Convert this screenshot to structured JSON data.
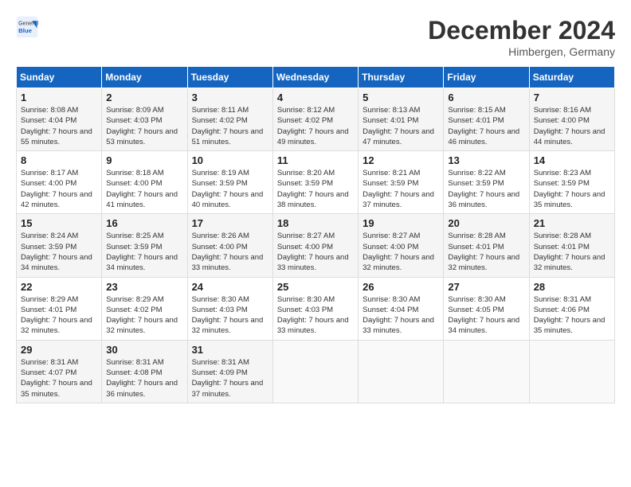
{
  "header": {
    "logo_general": "General",
    "logo_blue": "Blue",
    "month_title": "December 2024",
    "location": "Himbergen, Germany"
  },
  "days_of_week": [
    "Sunday",
    "Monday",
    "Tuesday",
    "Wednesday",
    "Thursday",
    "Friday",
    "Saturday"
  ],
  "weeks": [
    [
      {
        "day": "1",
        "sunrise": "Sunrise: 8:08 AM",
        "sunset": "Sunset: 4:04 PM",
        "daylight": "Daylight: 7 hours and 55 minutes."
      },
      {
        "day": "2",
        "sunrise": "Sunrise: 8:09 AM",
        "sunset": "Sunset: 4:03 PM",
        "daylight": "Daylight: 7 hours and 53 minutes."
      },
      {
        "day": "3",
        "sunrise": "Sunrise: 8:11 AM",
        "sunset": "Sunset: 4:02 PM",
        "daylight": "Daylight: 7 hours and 51 minutes."
      },
      {
        "day": "4",
        "sunrise": "Sunrise: 8:12 AM",
        "sunset": "Sunset: 4:02 PM",
        "daylight": "Daylight: 7 hours and 49 minutes."
      },
      {
        "day": "5",
        "sunrise": "Sunrise: 8:13 AM",
        "sunset": "Sunset: 4:01 PM",
        "daylight": "Daylight: 7 hours and 47 minutes."
      },
      {
        "day": "6",
        "sunrise": "Sunrise: 8:15 AM",
        "sunset": "Sunset: 4:01 PM",
        "daylight": "Daylight: 7 hours and 46 minutes."
      },
      {
        "day": "7",
        "sunrise": "Sunrise: 8:16 AM",
        "sunset": "Sunset: 4:00 PM",
        "daylight": "Daylight: 7 hours and 44 minutes."
      }
    ],
    [
      {
        "day": "8",
        "sunrise": "Sunrise: 8:17 AM",
        "sunset": "Sunset: 4:00 PM",
        "daylight": "Daylight: 7 hours and 42 minutes."
      },
      {
        "day": "9",
        "sunrise": "Sunrise: 8:18 AM",
        "sunset": "Sunset: 4:00 PM",
        "daylight": "Daylight: 7 hours and 41 minutes."
      },
      {
        "day": "10",
        "sunrise": "Sunrise: 8:19 AM",
        "sunset": "Sunset: 3:59 PM",
        "daylight": "Daylight: 7 hours and 40 minutes."
      },
      {
        "day": "11",
        "sunrise": "Sunrise: 8:20 AM",
        "sunset": "Sunset: 3:59 PM",
        "daylight": "Daylight: 7 hours and 38 minutes."
      },
      {
        "day": "12",
        "sunrise": "Sunrise: 8:21 AM",
        "sunset": "Sunset: 3:59 PM",
        "daylight": "Daylight: 7 hours and 37 minutes."
      },
      {
        "day": "13",
        "sunrise": "Sunrise: 8:22 AM",
        "sunset": "Sunset: 3:59 PM",
        "daylight": "Daylight: 7 hours and 36 minutes."
      },
      {
        "day": "14",
        "sunrise": "Sunrise: 8:23 AM",
        "sunset": "Sunset: 3:59 PM",
        "daylight": "Daylight: 7 hours and 35 minutes."
      }
    ],
    [
      {
        "day": "15",
        "sunrise": "Sunrise: 8:24 AM",
        "sunset": "Sunset: 3:59 PM",
        "daylight": "Daylight: 7 hours and 34 minutes."
      },
      {
        "day": "16",
        "sunrise": "Sunrise: 8:25 AM",
        "sunset": "Sunset: 3:59 PM",
        "daylight": "Daylight: 7 hours and 34 minutes."
      },
      {
        "day": "17",
        "sunrise": "Sunrise: 8:26 AM",
        "sunset": "Sunset: 4:00 PM",
        "daylight": "Daylight: 7 hours and 33 minutes."
      },
      {
        "day": "18",
        "sunrise": "Sunrise: 8:27 AM",
        "sunset": "Sunset: 4:00 PM",
        "daylight": "Daylight: 7 hours and 33 minutes."
      },
      {
        "day": "19",
        "sunrise": "Sunrise: 8:27 AM",
        "sunset": "Sunset: 4:00 PM",
        "daylight": "Daylight: 7 hours and 32 minutes."
      },
      {
        "day": "20",
        "sunrise": "Sunrise: 8:28 AM",
        "sunset": "Sunset: 4:01 PM",
        "daylight": "Daylight: 7 hours and 32 minutes."
      },
      {
        "day": "21",
        "sunrise": "Sunrise: 8:28 AM",
        "sunset": "Sunset: 4:01 PM",
        "daylight": "Daylight: 7 hours and 32 minutes."
      }
    ],
    [
      {
        "day": "22",
        "sunrise": "Sunrise: 8:29 AM",
        "sunset": "Sunset: 4:01 PM",
        "daylight": "Daylight: 7 hours and 32 minutes."
      },
      {
        "day": "23",
        "sunrise": "Sunrise: 8:29 AM",
        "sunset": "Sunset: 4:02 PM",
        "daylight": "Daylight: 7 hours and 32 minutes."
      },
      {
        "day": "24",
        "sunrise": "Sunrise: 8:30 AM",
        "sunset": "Sunset: 4:03 PM",
        "daylight": "Daylight: 7 hours and 32 minutes."
      },
      {
        "day": "25",
        "sunrise": "Sunrise: 8:30 AM",
        "sunset": "Sunset: 4:03 PM",
        "daylight": "Daylight: 7 hours and 33 minutes."
      },
      {
        "day": "26",
        "sunrise": "Sunrise: 8:30 AM",
        "sunset": "Sunset: 4:04 PM",
        "daylight": "Daylight: 7 hours and 33 minutes."
      },
      {
        "day": "27",
        "sunrise": "Sunrise: 8:30 AM",
        "sunset": "Sunset: 4:05 PM",
        "daylight": "Daylight: 7 hours and 34 minutes."
      },
      {
        "day": "28",
        "sunrise": "Sunrise: 8:31 AM",
        "sunset": "Sunset: 4:06 PM",
        "daylight": "Daylight: 7 hours and 35 minutes."
      }
    ],
    [
      {
        "day": "29",
        "sunrise": "Sunrise: 8:31 AM",
        "sunset": "Sunset: 4:07 PM",
        "daylight": "Daylight: 7 hours and 35 minutes."
      },
      {
        "day": "30",
        "sunrise": "Sunrise: 8:31 AM",
        "sunset": "Sunset: 4:08 PM",
        "daylight": "Daylight: 7 hours and 36 minutes."
      },
      {
        "day": "31",
        "sunrise": "Sunrise: 8:31 AM",
        "sunset": "Sunset: 4:09 PM",
        "daylight": "Daylight: 7 hours and 37 minutes."
      },
      null,
      null,
      null,
      null
    ]
  ]
}
